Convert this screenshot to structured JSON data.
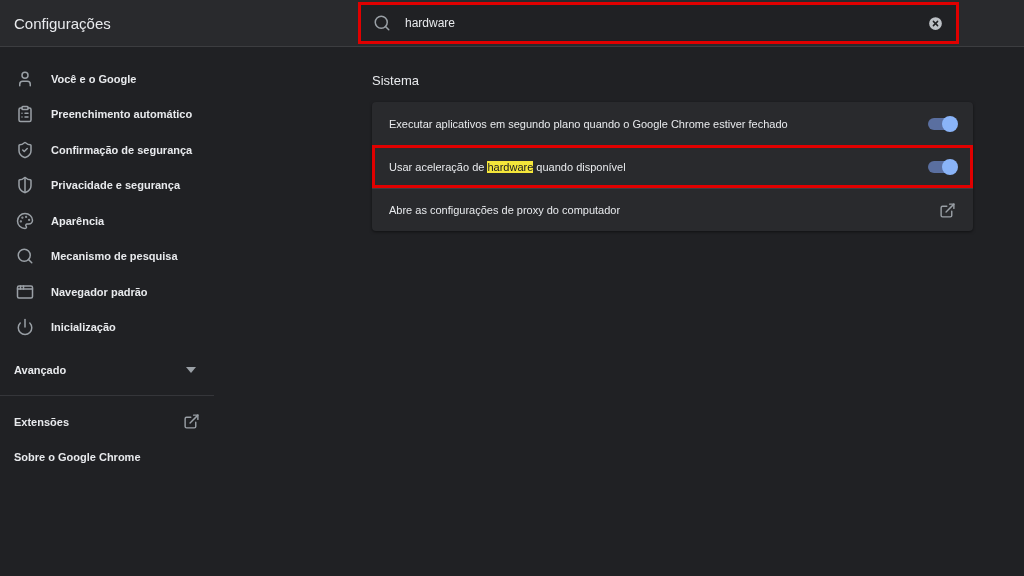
{
  "header": {
    "title": "Configurações"
  },
  "search": {
    "value": "hardware",
    "annotated": true
  },
  "sidebar": {
    "items": [
      {
        "label": "Você e o Google",
        "selected": false
      },
      {
        "label": "Preenchimento automático",
        "selected": false
      },
      {
        "label": "Confirmação de segurança",
        "selected": false
      },
      {
        "label": "Privacidade e segurança",
        "selected": false
      },
      {
        "label": "Aparência",
        "selected": false
      },
      {
        "label": "Mecanismo de pesquisa",
        "selected": false
      },
      {
        "label": "Navegador padrão",
        "selected": false
      },
      {
        "label": "Inicialização",
        "selected": false
      }
    ],
    "advanced": {
      "label": "Avançado",
      "expanded": false
    },
    "links": [
      {
        "label": "Extensões",
        "external": true
      },
      {
        "label": "Sobre o Google Chrome",
        "external": false
      }
    ]
  },
  "section": {
    "title": "Sistema",
    "rows": [
      {
        "kind": "toggle",
        "on": true,
        "annotated": false,
        "parts": [
          {
            "text": "Executar aplicativos em segundo plano quando o Google Chrome estiver fechado",
            "highlighted": false
          }
        ]
      },
      {
        "kind": "toggle",
        "on": true,
        "annotated": true,
        "parts": [
          {
            "text": "Usar aceleração de ",
            "highlighted": false
          },
          {
            "text": "hardware",
            "highlighted": true
          },
          {
            "text": " quando disponível",
            "highlighted": false
          }
        ]
      },
      {
        "kind": "link",
        "annotated": false,
        "parts": [
          {
            "text": "Abre as configurações de proxy do computador",
            "highlighted": false
          }
        ]
      }
    ]
  }
}
